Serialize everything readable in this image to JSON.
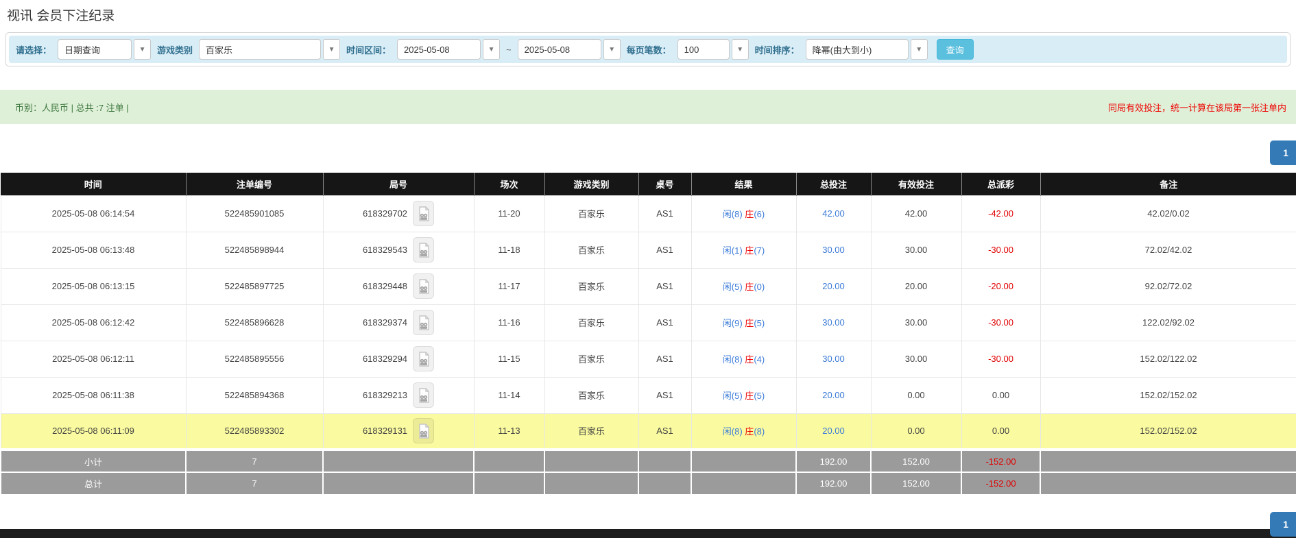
{
  "page_title": "视讯 会员下注纪录",
  "filters": {
    "select_label": "请选择：",
    "select_value": "日期查询",
    "game_type_label": "游戏类别",
    "game_type_value": "百家乐",
    "time_range_label": "时间区间：",
    "date_from": "2025-05-08",
    "tilde": "~",
    "date_to": "2025-05-08",
    "page_size_label": "每页笔数：",
    "page_size_value": "100",
    "sort_label": "时间排序：",
    "sort_value": "降幂(由大到小)",
    "search_button": "查询"
  },
  "summary": {
    "left_text": "币别：人民币 | 总共 :7 注单 |",
    "right_notice": "同局有效投注，统一计算在该局第一张注单内"
  },
  "pagination": {
    "page": "1"
  },
  "icons": {
    "dropdown": "▼"
  },
  "colors": {
    "link_blue": "#3b7bd8",
    "loss_red": "#ee0000",
    "highlight_yellow": "#fafaa0",
    "header_black": "#161616",
    "sum_grey": "#9b9b9b",
    "search_button_cyan": "#5bc0de",
    "pager_blue": "#337ab7",
    "filter_bar_blue": "#d9edf7",
    "summary_green": "#dff0d8"
  },
  "table": {
    "headers": [
      "时间",
      "注单编号",
      "局号",
      "场次",
      "游戏类别",
      "桌号",
      "结果",
      "总投注",
      "有效投注",
      "总派彩",
      "备注"
    ],
    "rows": [
      {
        "time": "2025-05-08 06:14:54",
        "bet_id": "522485901085",
        "round_id": "618329702",
        "session": "11-20",
        "game": "百家乐",
        "table_no": "AS1",
        "result": {
          "player": "闲(8)",
          "banker": "庄",
          "banker_score": "(6)"
        },
        "total_bet": "42.00",
        "valid_bet": "42.00",
        "payout": "-42.00",
        "remark": "42.02/0.02",
        "highlight": false
      },
      {
        "time": "2025-05-08 06:13:48",
        "bet_id": "522485898944",
        "round_id": "618329543",
        "session": "11-18",
        "game": "百家乐",
        "table_no": "AS1",
        "result": {
          "player": "闲(1)",
          "banker": "庄",
          "banker_score": "(7)"
        },
        "total_bet": "30.00",
        "valid_bet": "30.00",
        "payout": "-30.00",
        "remark": "72.02/42.02",
        "highlight": false
      },
      {
        "time": "2025-05-08 06:13:15",
        "bet_id": "522485897725",
        "round_id": "618329448",
        "session": "11-17",
        "game": "百家乐",
        "table_no": "AS1",
        "result": {
          "player": "闲(5)",
          "banker": "庄",
          "banker_score": "(0)"
        },
        "total_bet": "20.00",
        "valid_bet": "20.00",
        "payout": "-20.00",
        "remark": "92.02/72.02",
        "highlight": false
      },
      {
        "time": "2025-05-08 06:12:42",
        "bet_id": "522485896628",
        "round_id": "618329374",
        "session": "11-16",
        "game": "百家乐",
        "table_no": "AS1",
        "result": {
          "player": "闲(9)",
          "banker": "庄",
          "banker_score": "(5)"
        },
        "total_bet": "30.00",
        "valid_bet": "30.00",
        "payout": "-30.00",
        "remark": "122.02/92.02",
        "highlight": false
      },
      {
        "time": "2025-05-08 06:12:11",
        "bet_id": "522485895556",
        "round_id": "618329294",
        "session": "11-15",
        "game": "百家乐",
        "table_no": "AS1",
        "result": {
          "player": "闲(8)",
          "banker": "庄",
          "banker_score": "(4)"
        },
        "total_bet": "30.00",
        "valid_bet": "30.00",
        "payout": "-30.00",
        "remark": "152.02/122.02",
        "highlight": false
      },
      {
        "time": "2025-05-08 06:11:38",
        "bet_id": "522485894368",
        "round_id": "618329213",
        "session": "11-14",
        "game": "百家乐",
        "table_no": "AS1",
        "result": {
          "player": "闲(5)",
          "banker": "庄",
          "banker_score": "(5)"
        },
        "total_bet": "20.00",
        "valid_bet": "0.00",
        "payout": "0.00",
        "remark": "152.02/152.02",
        "highlight": false
      },
      {
        "time": "2025-05-08 06:11:09",
        "bet_id": "522485893302",
        "round_id": "618329131",
        "session": "11-13",
        "game": "百家乐",
        "table_no": "AS1",
        "result": {
          "player": "闲(8)",
          "banker": "庄",
          "banker_score": "(8)"
        },
        "total_bet": "20.00",
        "valid_bet": "0.00",
        "payout": "0.00",
        "remark": "152.02/152.02",
        "highlight": true
      }
    ],
    "subtotal": {
      "label": "小计",
      "count": "7",
      "total_bet": "192.00",
      "valid_bet": "152.00",
      "payout": "-152.00"
    },
    "total": {
      "label": "总计",
      "count": "7",
      "total_bet": "192.00",
      "valid_bet": "152.00",
      "payout": "-152.00"
    }
  }
}
